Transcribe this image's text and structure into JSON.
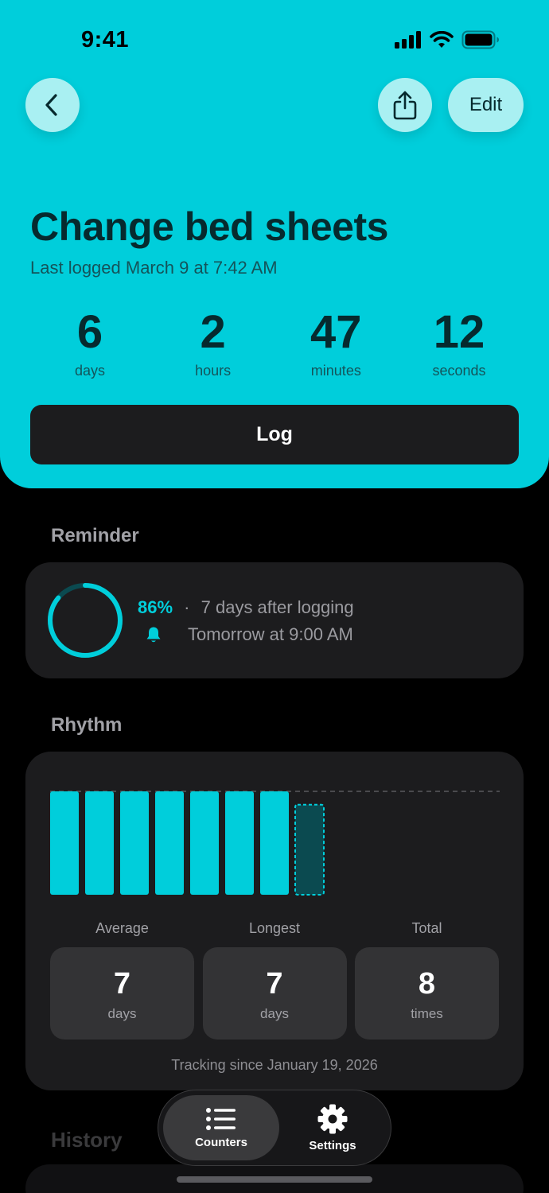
{
  "status_bar": {
    "time": "9:41"
  },
  "header": {
    "edit_label": "Edit",
    "title": "Change bed sheets",
    "subtitle": "Last logged March 9 at 7:42 AM",
    "timer": [
      {
        "value": "6",
        "unit": "days"
      },
      {
        "value": "2",
        "unit": "hours"
      },
      {
        "value": "47",
        "unit": "minutes"
      },
      {
        "value": "12",
        "unit": "seconds"
      }
    ],
    "log_label": "Log"
  },
  "reminder": {
    "section_title": "Reminder",
    "percent": "86%",
    "progress": 0.86,
    "separator": "·",
    "interval": "7 days after logging",
    "next": "Tomorrow at 9:00 AM"
  },
  "rhythm": {
    "section_title": "Rhythm",
    "bars": [
      7,
      7,
      7,
      7,
      7,
      7,
      7,
      6.1
    ],
    "stats": [
      {
        "label": "Average",
        "value": "7",
        "unit": "days"
      },
      {
        "label": "Longest",
        "value": "7",
        "unit": "days"
      },
      {
        "label": "Total",
        "value": "8",
        "unit": "times"
      }
    ],
    "tracking": "Tracking since January 19, 2026"
  },
  "history": {
    "section_title": "History"
  },
  "tabbar": {
    "tabs": [
      {
        "label": "Counters",
        "icon": "list-icon"
      },
      {
        "label": "Settings",
        "icon": "gear-icon"
      }
    ]
  },
  "colors": {
    "accent": "#00cedb",
    "card": "#1c1c1e",
    "background": "#000000"
  }
}
